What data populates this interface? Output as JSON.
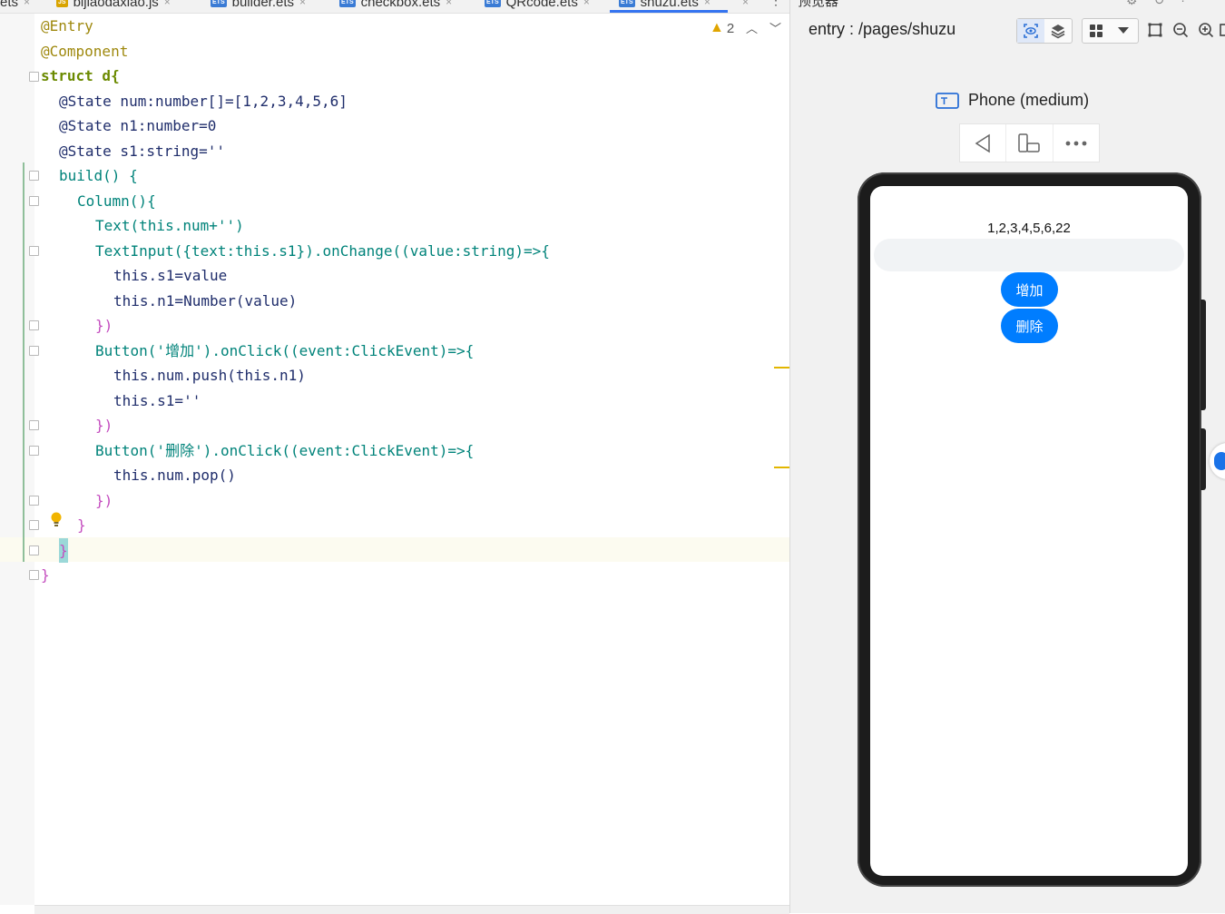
{
  "tabs": [
    {
      "label": "ets",
      "type": ""
    },
    {
      "label": "bijiaodaxiao.js",
      "type": "JS"
    },
    {
      "label": "builder.ets",
      "type": "ETS"
    },
    {
      "label": "checkbox.ets",
      "type": "ETS"
    },
    {
      "label": "QRcode.ets",
      "type": "ETS"
    },
    {
      "label": "shuzu.ets",
      "type": "ETS",
      "active": true
    }
  ],
  "editor": {
    "warning_count": "2",
    "lines": [
      "@Entry",
      "@Component",
      "struct d{",
      "@State num:number[]=[1,2,3,4,5,6]",
      "@State n1:number=0",
      "@State s1:string=''",
      "build() {",
      "Column(){",
      "Text(this.num+'')",
      "TextInput({text:this.s1}).onChange((value:string)=>{",
      "this.s1=value",
      "this.n1=Number(value)",
      "})",
      "Button('增加').onClick((event:ClickEvent)=>{",
      "this.num.push(this.n1)",
      "this.s1=''",
      "})",
      "Button('删除').onClick((event:ClickEvent)=>{",
      "this.num.pop()",
      "})",
      "}",
      "}",
      "}"
    ]
  },
  "previewer": {
    "panel_title": "预览器",
    "path": "entry : /pages/shuzu",
    "device_name": "Phone (medium)",
    "app": {
      "text": "1,2,3,4,5,6,22",
      "input_value": "",
      "add_label": "增加",
      "delete_label": "删除"
    }
  },
  "colors": {
    "accent": "#3574f0",
    "app_button": "#007dff",
    "warning": "#e0a500"
  }
}
